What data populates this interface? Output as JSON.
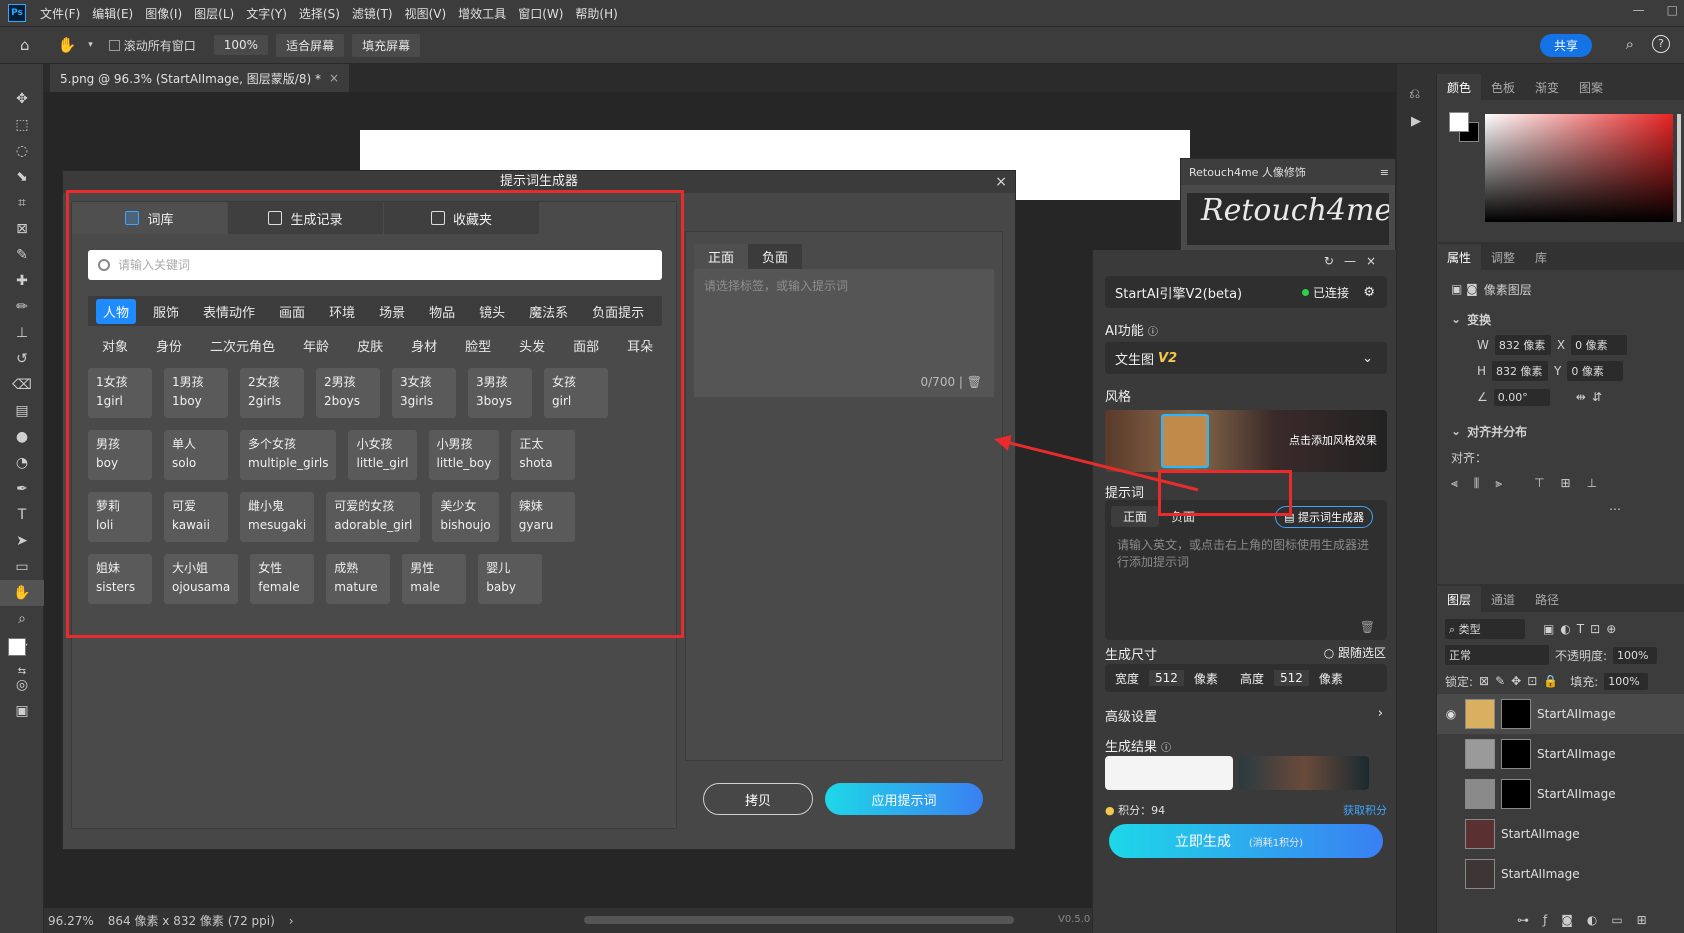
{
  "app": {
    "logo": "Ps",
    "menu": [
      "文件(F)",
      "编辑(E)",
      "图像(I)",
      "图层(L)",
      "文字(Y)",
      "选择(S)",
      "滤镜(T)",
      "视图(V)",
      "增效工具",
      "窗口(W)",
      "帮助(H)"
    ]
  },
  "options": {
    "scroll_all": "滚动所有窗口",
    "zoom": "100%",
    "fit_screen": "适合屏幕",
    "fill_screen": "填充屏幕",
    "share": "共享"
  },
  "doc": {
    "tab_title": "5.png @ 96.3% (StartAIImage, 图层蒙版/8) *",
    "zoom_status": "96.27%",
    "size_status": "864 像素 x 832 像素 (72 ppi)",
    "version": "V0.5.0"
  },
  "color_panel": {
    "tabs": [
      "颜色",
      "色板",
      "渐变",
      "图案"
    ]
  },
  "props_panel": {
    "tabs": [
      "属性",
      "调整",
      "库"
    ],
    "layer_type": "像素图层",
    "transform": "变换",
    "w_label": "W",
    "w_value": "832 像素",
    "x_label": "X",
    "x_value": "0 像素",
    "h_label": "H",
    "h_value": "832 像素",
    "y_label": "Y",
    "y_value": "0 像素",
    "angle": "0.00°",
    "align_title": "对齐并分布",
    "align_label": "对齐："
  },
  "layers_panel": {
    "tabs": [
      "图层",
      "通道",
      "路径"
    ],
    "filter": "类型",
    "blend": "正常",
    "opacity_label": "不透明度:",
    "opacity": "100%",
    "lock_label": "锁定:",
    "fill_label": "填充:",
    "fill": "100%",
    "layers": [
      {
        "name": "StartAIImage"
      },
      {
        "name": "StartAIImage"
      },
      {
        "name": "StartAIImage"
      },
      {
        "name": "StartAIImage"
      },
      {
        "name": "StartAIImage"
      }
    ]
  },
  "retouch": {
    "title": "Retouch4me 人像修饰",
    "brand": "Retouch4me"
  },
  "startai": {
    "engine": "StartAI引擎V2(beta)",
    "status": "已连接",
    "ai_func_label": "AI功能",
    "mode": "文生图",
    "mode_version": "V2",
    "style_label": "风格",
    "style_hint": "点击添加风格效果",
    "prompt_label": "提示词",
    "prompt_tabs": [
      "正面",
      "负面"
    ],
    "prompt_gen_btn": "提示词生成器",
    "prompt_placeholder": "请输入英文，或点击右上角的图标使用生成器进行添加提示词",
    "size_label": "生成尺寸",
    "follow_selection": "跟随选区",
    "width_label": "宽度",
    "width_value": "512",
    "width_unit": "像素",
    "height_label": "高度",
    "height_value": "512",
    "height_unit": "像素",
    "advanced": "高级设置",
    "results_label": "生成结果",
    "points": "积分：94",
    "get_points": "获取积分",
    "generate": "立即生成",
    "generate_cost": "(消耗1积分)"
  },
  "dialog": {
    "title": "提示词生成器",
    "tabs": [
      "词库",
      "生成记录",
      "收藏夹"
    ],
    "search_placeholder": "请输入关键词",
    "categories": [
      "人物",
      "服饰",
      "表情动作",
      "画面",
      "环境",
      "场景",
      "物品",
      "镜头",
      "魔法系",
      "负面提示"
    ],
    "subcategories": [
      "对象",
      "身份",
      "二次元角色",
      "年龄",
      "皮肤",
      "身材",
      "脸型",
      "头发",
      "面部",
      "耳朵"
    ],
    "tag_rows": [
      [
        {
          "cn": "1女孩",
          "en": "1girl"
        },
        {
          "cn": "1男孩",
          "en": "1boy"
        },
        {
          "cn": "2女孩",
          "en": "2girls"
        },
        {
          "cn": "2男孩",
          "en": "2boys"
        },
        {
          "cn": "3女孩",
          "en": "3girls"
        },
        {
          "cn": "3男孩",
          "en": "3boys"
        },
        {
          "cn": "女孩",
          "en": "girl"
        }
      ],
      [
        {
          "cn": "男孩",
          "en": "boy"
        },
        {
          "cn": "单人",
          "en": "solo"
        },
        {
          "cn": "多个女孩",
          "en": "multiple_girls"
        },
        {
          "cn": "小女孩",
          "en": "little_girl"
        },
        {
          "cn": "小男孩",
          "en": "little_boy"
        },
        {
          "cn": "正太",
          "en": "shota"
        }
      ],
      [
        {
          "cn": "萝莉",
          "en": "loli"
        },
        {
          "cn": "可爱",
          "en": "kawaii"
        },
        {
          "cn": "雌小鬼",
          "en": "mesugaki"
        },
        {
          "cn": "可爱的女孩",
          "en": "adorable_girl"
        },
        {
          "cn": "美少女",
          "en": "bishoujo"
        },
        {
          "cn": "辣妹",
          "en": "gyaru"
        }
      ],
      [
        {
          "cn": "姐妹",
          "en": "sisters"
        },
        {
          "cn": "大小姐",
          "en": "ojousama"
        },
        {
          "cn": "女性",
          "en": "female"
        },
        {
          "cn": "成熟",
          "en": "mature"
        },
        {
          "cn": "男性",
          "en": "male"
        },
        {
          "cn": "婴儿",
          "en": "baby"
        }
      ]
    ],
    "right_tabs": [
      "正面",
      "负面"
    ],
    "right_placeholder": "请选择标签，或输入提示词",
    "counter": "0/700",
    "copy": "拷贝",
    "apply": "应用提示词"
  }
}
